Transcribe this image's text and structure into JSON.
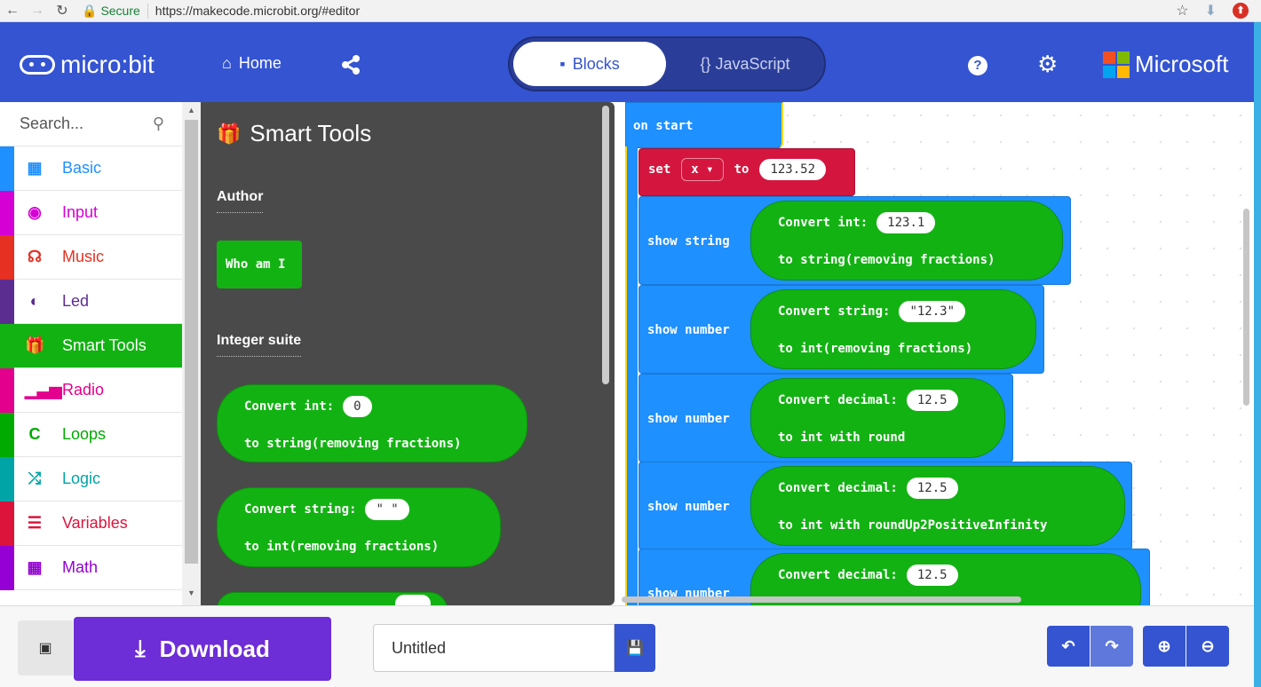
{
  "browser": {
    "secure_label": "Secure",
    "url": "https://makecode.microbit.org/#editor"
  },
  "menu": {
    "logo_text": "micro:bit",
    "home_label": "Home",
    "tab_blocks": "Blocks",
    "tab_javascript": "{} JavaScript",
    "microsoft_label": "Microsoft"
  },
  "toolbox": {
    "search_placeholder": "Search...",
    "categories": [
      {
        "label": "Basic",
        "color": "#1e90ff",
        "icon": "grid-icon"
      },
      {
        "label": "Input",
        "color": "#d400d4",
        "icon": "target-icon"
      },
      {
        "label": "Music",
        "color": "#e63022",
        "icon": "headphones-icon"
      },
      {
        "label": "Led",
        "color": "#5c2d91",
        "icon": "toggle-icon"
      },
      {
        "label": "Smart Tools",
        "color": "#13b213",
        "icon": "gift-icon",
        "selected": true
      },
      {
        "label": "Radio",
        "color": "#e3008c",
        "icon": "signal-icon"
      },
      {
        "label": "Loops",
        "color": "#00aa00",
        "icon": "loop-icon"
      },
      {
        "label": "Logic",
        "color": "#00a4a6",
        "icon": "shuffle-icon"
      },
      {
        "label": "Variables",
        "color": "#dc143c",
        "icon": "lines-icon"
      },
      {
        "label": "Math",
        "color": "#9400d3",
        "icon": "calculator-icon"
      }
    ]
  },
  "flyout": {
    "title": "Smart Tools",
    "author_label": "Author",
    "who_am_i": "Who am I",
    "integer_suite_label": "Integer suite",
    "convert_int_label": "Convert int:",
    "convert_int_value": "0",
    "to_string_label": "to string(removing fractions)",
    "convert_string_label": "Convert string:",
    "convert_string_value": "\" \"",
    "to_int_label": "to int(removing fractions)"
  },
  "workspace": {
    "on_start": "on start",
    "set_label": "set",
    "var_name": "x ▾",
    "to_label": "to",
    "set_value": "123.52",
    "show_string": "show string",
    "show_number": "show number",
    "b1_convert": "Convert int:",
    "b1_value": "123.1",
    "b1_to": "to string(removing fractions)",
    "b2_convert": "Convert string:",
    "b2_value": "\"12.3\"",
    "b2_to": "to int(removing fractions)",
    "b3_convert": "Convert decimal:",
    "b3_value": "12.5",
    "b3_to": "to int with round",
    "b4_convert": "Convert decimal:",
    "b4_value": "12.5",
    "b4_to": "to int with roundUp2PositiveInfinity",
    "b5_convert": "Convert decimal:",
    "b5_value": "12.5",
    "b5_show": "show number"
  },
  "bottom": {
    "download_label": "Download",
    "project_name": "Untitled"
  }
}
